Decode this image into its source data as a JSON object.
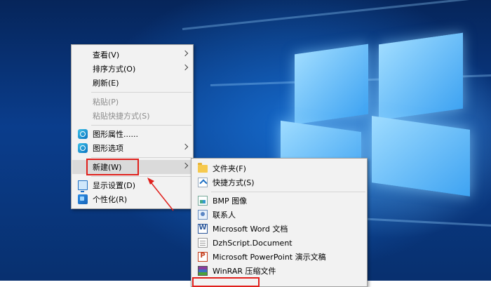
{
  "context_menu": {
    "items": [
      {
        "label": "查看(V)",
        "submenu": true
      },
      {
        "label": "排序方式(O)",
        "submenu": true
      },
      {
        "label": "刷新(E)"
      },
      {
        "label": "粘贴(P)",
        "disabled": true
      },
      {
        "label": "粘贴快捷方式(S)",
        "disabled": true
      },
      {
        "label": "图形属性......",
        "icon": "intel-graphics-icon"
      },
      {
        "label": "图形选项",
        "icon": "intel-graphics-icon",
        "submenu": true
      },
      {
        "label": "新建(W)",
        "submenu": true,
        "highlighted": true
      },
      {
        "label": "显示设置(D)",
        "icon": "display-settings-icon"
      },
      {
        "label": "个性化(R)",
        "icon": "personalize-icon"
      }
    ]
  },
  "new_submenu": {
    "items": [
      {
        "label": "文件夹(F)",
        "icon": "folder-icon"
      },
      {
        "label": "快捷方式(S)",
        "icon": "shortcut-icon"
      },
      {
        "label": "BMP 图像",
        "icon": "bmp-image-icon"
      },
      {
        "label": "联系人",
        "icon": "contact-icon"
      },
      {
        "label": "Microsoft Word 文档",
        "icon": "word-document-icon"
      },
      {
        "label": "DzhScript.Document",
        "icon": "document-icon"
      },
      {
        "label": "Microsoft PowerPoint 演示文稿",
        "icon": "powerpoint-icon"
      },
      {
        "label": "WinRAR 压缩文件",
        "icon": "winrar-archive-icon"
      }
    ]
  },
  "colors": {
    "annotation": "#e0201c",
    "menu_bg": "#f2f2f2",
    "highlight": "#dadada"
  }
}
